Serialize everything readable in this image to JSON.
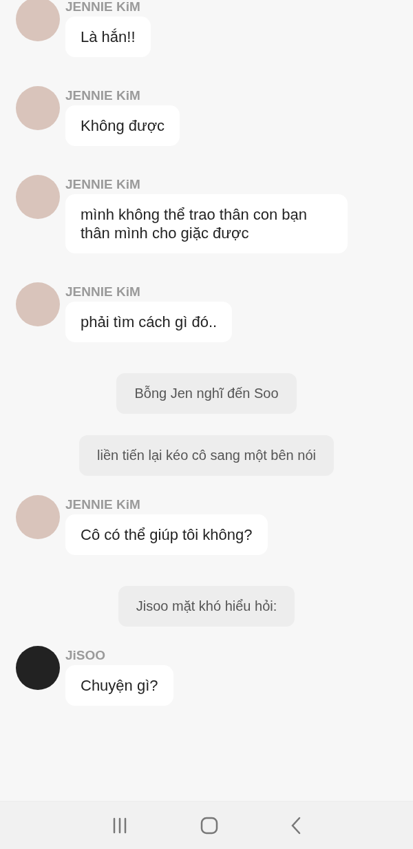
{
  "messages": [
    {
      "kind": "message",
      "sender": "JENNIE KiM",
      "color": "#d9c4bb",
      "text": "Là hắn!!"
    },
    {
      "kind": "message",
      "sender": "JENNIE KiM",
      "color": "#d9c4bb",
      "text": "Không được"
    },
    {
      "kind": "message",
      "sender": "JENNIE KiM",
      "color": "#d9c4bb",
      "text": "mình không thể trao thân con bạn thân mình cho giặc được"
    },
    {
      "kind": "message",
      "sender": "JENNIE KiM",
      "color": "#d9c4bb",
      "text": "phải tìm cách gì đó.."
    },
    {
      "kind": "narration",
      "text": "Bỗng Jen nghĩ đến Soo"
    },
    {
      "kind": "narration",
      "text": "liền tiến lại kéo cô sang một bên nói"
    },
    {
      "kind": "message",
      "sender": "JENNIE KiM",
      "color": "#d9c4bb",
      "text": "Cô có thể giúp tôi không?"
    },
    {
      "kind": "narration",
      "text": "Jisoo mặt khó hiểu hỏi:"
    },
    {
      "kind": "message",
      "sender": "JiSOO",
      "color": "#222222",
      "text": "Chuyện gì?"
    }
  ]
}
